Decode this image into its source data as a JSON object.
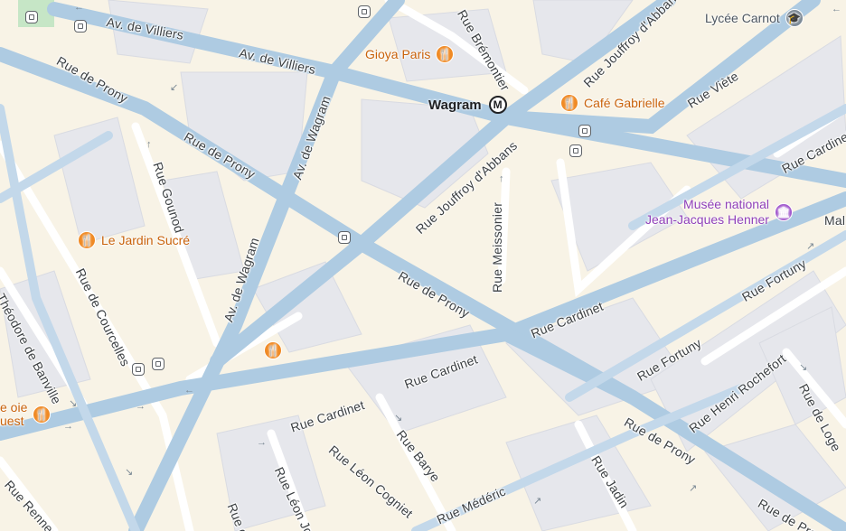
{
  "map": {
    "colors": {
      "background": "#f8f3e6",
      "building": "#e6e7ec",
      "road_major": "#aecbe2",
      "road_minor": "#ffffff",
      "park": "#c6e6c6",
      "food_pin": "#f08a24",
      "museum_pin": "#a055cc"
    },
    "streets": [
      {
        "id": "av-villiers-1",
        "name": "Av. de Villiers"
      },
      {
        "id": "av-villiers-2",
        "name": "Av. de Villiers"
      },
      {
        "id": "rue-prony-1",
        "name": "Rue de Prony"
      },
      {
        "id": "rue-prony-2",
        "name": "Rue de Prony"
      },
      {
        "id": "rue-prony-3",
        "name": "Rue de Prony"
      },
      {
        "id": "rue-prony-4",
        "name": "Rue de Prony"
      },
      {
        "id": "rue-prony-5",
        "name": "Rue de Prony"
      },
      {
        "id": "av-wagram-1",
        "name": "Av. de Wagram"
      },
      {
        "id": "av-wagram-2",
        "name": "Av. de Wagram"
      },
      {
        "id": "rue-gounod",
        "name": "Rue Gounod"
      },
      {
        "id": "rue-courcelles",
        "name": "Rue de Courcelles"
      },
      {
        "id": "theodore-banville",
        "name": "Théodore de Banville"
      },
      {
        "id": "rue-bremontier",
        "name": "Rue Brémontier"
      },
      {
        "id": "rue-jouffroy-1",
        "name": "Rue Jouffroy d'Abbans"
      },
      {
        "id": "rue-jouffroy-2",
        "name": "Rue Jouffroy d'Abbans"
      },
      {
        "id": "rue-viete",
        "name": "Rue Viète"
      },
      {
        "id": "rue-cardinet-1",
        "name": "Rue Cardinet"
      },
      {
        "id": "rue-cardinet-2",
        "name": "Rue Cardinet"
      },
      {
        "id": "rue-cardinet-3",
        "name": "Rue Cardinet"
      },
      {
        "id": "rue-cardinet-4",
        "name": "Rue Cardinet"
      },
      {
        "id": "rue-meissonier",
        "name": "Rue Meissonier"
      },
      {
        "id": "rue-fortuny-1",
        "name": "Rue Fortuny"
      },
      {
        "id": "rue-fortuny-2",
        "name": "Rue Fortuny"
      },
      {
        "id": "rue-henri-rochefort",
        "name": "Rue Henri Rochefort"
      },
      {
        "id": "rue-de-logelbach",
        "name": "Rue de Loge"
      },
      {
        "id": "rue-leon-cogniet",
        "name": "Rue Léon Cogniet"
      },
      {
        "id": "rue-leon-jost",
        "name": "Rue Léon Jost"
      },
      {
        "id": "rue-barye",
        "name": "Rue Barye"
      },
      {
        "id": "rue-jadin",
        "name": "Rue Jadin"
      },
      {
        "id": "rue-mederic",
        "name": "Rue Médéric"
      },
      {
        "id": "rue-renneq",
        "name": "Rue Renneq"
      },
      {
        "id": "rue-de-edge",
        "name": "Rue de"
      }
    ],
    "places": {
      "lycee": {
        "name": "Lycée Carnot",
        "icon": "school-icon"
      },
      "gioya": {
        "name": "Gioya Paris",
        "icon": "fork-knife-icon"
      },
      "gabrielle": {
        "name": "Café Gabrielle",
        "icon": "fork-knife-icon"
      },
      "jardin": {
        "name": "Le Jardin Sucré",
        "icon": "fork-knife-icon"
      },
      "museum": {
        "line1": "Musée national",
        "line2": "Jean-Jacques Henner",
        "icon": "museum-icon"
      },
      "oie": {
        "line1": "e oie",
        "line2": "uest",
        "icon": "fork-knife-icon"
      },
      "unnamed_food": {
        "icon": "fork-knife-icon"
      }
    },
    "metro": {
      "name": "Wagram",
      "badge": "M"
    },
    "edge_label": "Mal"
  }
}
